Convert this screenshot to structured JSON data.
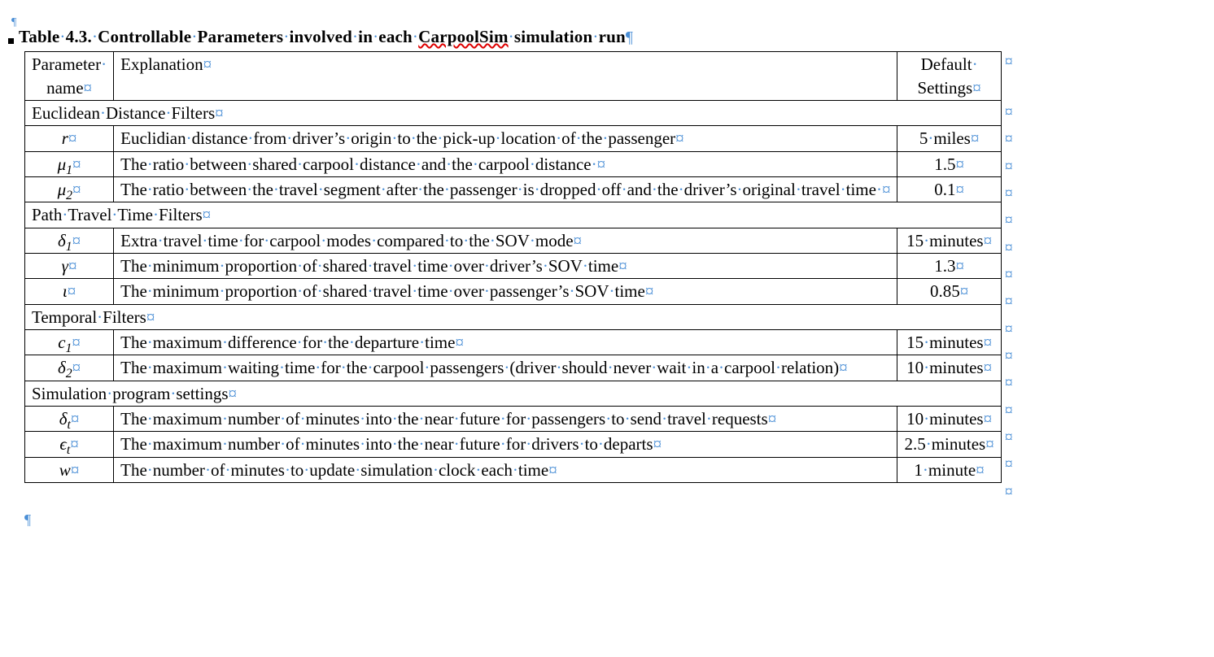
{
  "marks": {
    "pilcrow": "¶",
    "cell": "¤",
    "dot": "·",
    "gutter": "¤"
  },
  "caption": {
    "prefix": "Table 4.3. Controllable Parameters involved in each ",
    "underlined": "CarpoolSim",
    "suffix": " simulation run"
  },
  "headers": {
    "param": "Parameter name",
    "expl": "Explanation",
    "def": "Default Settings"
  },
  "sections": [
    {
      "title": "Euclidean Distance Filters",
      "rows": [
        {
          "sym_base": "r",
          "sym_sub": "",
          "expl": "Euclidian distance from driver's origin to the pick-up location of the passenger",
          "def": "5 miles"
        },
        {
          "sym_base": "μ",
          "sym_sub": "1",
          "expl": "The ratio between shared carpool distance and the carpool distance ",
          "def": "1.5"
        },
        {
          "sym_base": "μ",
          "sym_sub": "2",
          "expl": "The ratio between the travel segment after the passenger is dropped off and the driver's original travel time ",
          "def": "0.1"
        }
      ]
    },
    {
      "title": "Path Travel Time Filters",
      "rows": [
        {
          "sym_base": "δ",
          "sym_sub": "1",
          "expl": "Extra travel time for carpool modes compared to the SOV mode",
          "def": "15 minutes"
        },
        {
          "sym_base": "γ",
          "sym_sub": "",
          "expl": "The minimum proportion of shared travel time over driver's SOV time",
          "def": "1.3"
        },
        {
          "sym_base": "ι",
          "sym_sub": "",
          "expl": "The minimum proportion of shared travel time over passenger's SOV time",
          "def": "0.85"
        }
      ]
    },
    {
      "title": "Temporal Filters",
      "rows": [
        {
          "sym_base": "c",
          "sym_sub": "1",
          "expl": "The maximum difference for the departure time",
          "def": "15 minutes"
        },
        {
          "sym_base": "δ",
          "sym_sub": "2",
          "expl": "The maximum waiting time for the carpool passengers (driver should never wait in a carpool relation)",
          "def": "10 minutes"
        }
      ]
    },
    {
      "title": "Simulation program settings",
      "rows": [
        {
          "sym_base": "δ",
          "sym_sub": "t",
          "expl": "The maximum number of minutes into the near future for passengers to send travel requests",
          "def": "10 minutes"
        },
        {
          "sym_base": "ϵ",
          "sym_sub": "t",
          "expl": "The maximum number of minutes into the near future for drivers to departs",
          "def": "2.5 minutes"
        },
        {
          "sym_base": "w",
          "sym_sub": "",
          "expl": "The number of minutes to update simulation clock each time",
          "def": "1 minute"
        }
      ]
    }
  ]
}
